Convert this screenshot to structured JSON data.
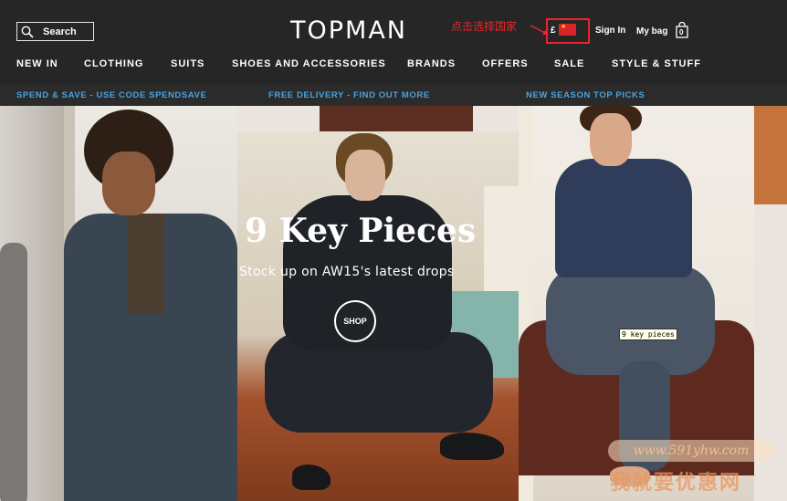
{
  "header": {
    "search_label": "Search",
    "logo": "TOPMAN",
    "annotation": "点击选择国家",
    "currency": "£",
    "sign_in": "Sign In",
    "my_bag": "My bag",
    "bag_count": "0"
  },
  "nav": {
    "items": [
      "NEW IN",
      "CLOTHING",
      "SUITS",
      "SHOES AND ACCESSORIES",
      "BRANDS",
      "OFFERS",
      "SALE",
      "STYLE & STUFF"
    ]
  },
  "promos": [
    "SPEND & SAVE - USE CODE SPENDSAVE",
    "FREE DELIVERY - FIND OUT MORE",
    "NEW SEASON TOP PICKS"
  ],
  "hero": {
    "title": "9 Key Pieces",
    "subtitle": "Stock up on AW15's latest drops",
    "shop_label": "SHOP",
    "tooltip": "9 key pieces"
  },
  "watermark": {
    "url": "www.591yhw.com",
    "text": "我就要优惠网"
  },
  "colors": {
    "header_bg": "#262626",
    "promo_text": "#4aa3df",
    "annotation_red": "#e8262c"
  }
}
